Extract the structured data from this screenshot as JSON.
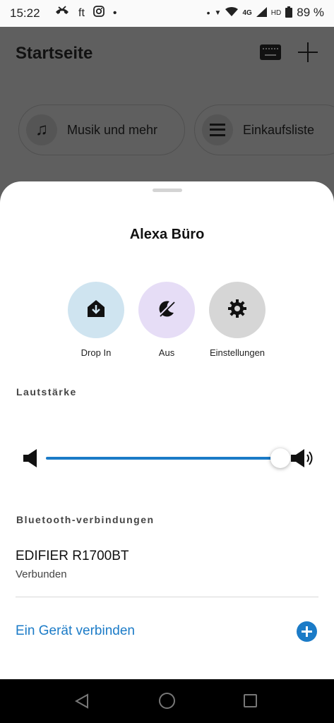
{
  "status_bar": {
    "time": "15:22",
    "left_icons": [
      "missed-call-icon",
      "ft",
      "instagram-icon",
      "•"
    ],
    "network": "4G",
    "hd": "HD",
    "battery": "89 %"
  },
  "app": {
    "title": "Startseite",
    "chips": [
      {
        "label": "Musik und mehr",
        "icon": "music-note-icon"
      },
      {
        "label": "Einkaufsliste",
        "icon": "list-icon"
      }
    ]
  },
  "sheet": {
    "title": "Alexa Büro",
    "actions": [
      {
        "label": "Drop In",
        "icon": "drop-in-icon",
        "color": "#cfe4f0"
      },
      {
        "label": "Aus",
        "icon": "do-not-disturb-icon",
        "color": "#e6ddf6"
      },
      {
        "label": "Einstellungen",
        "icon": "gear-icon",
        "color": "#d6d6d6"
      }
    ],
    "volume_label": "Lautstärke",
    "volume_level": 1.0,
    "bluetooth_label": "Bluetooth-verbindungen",
    "device": {
      "name": "EDIFIER R1700BT",
      "status": "Verbunden"
    },
    "connect_label": "Ein Gerät verbinden"
  },
  "colors": {
    "accent": "#1b7bc7"
  }
}
